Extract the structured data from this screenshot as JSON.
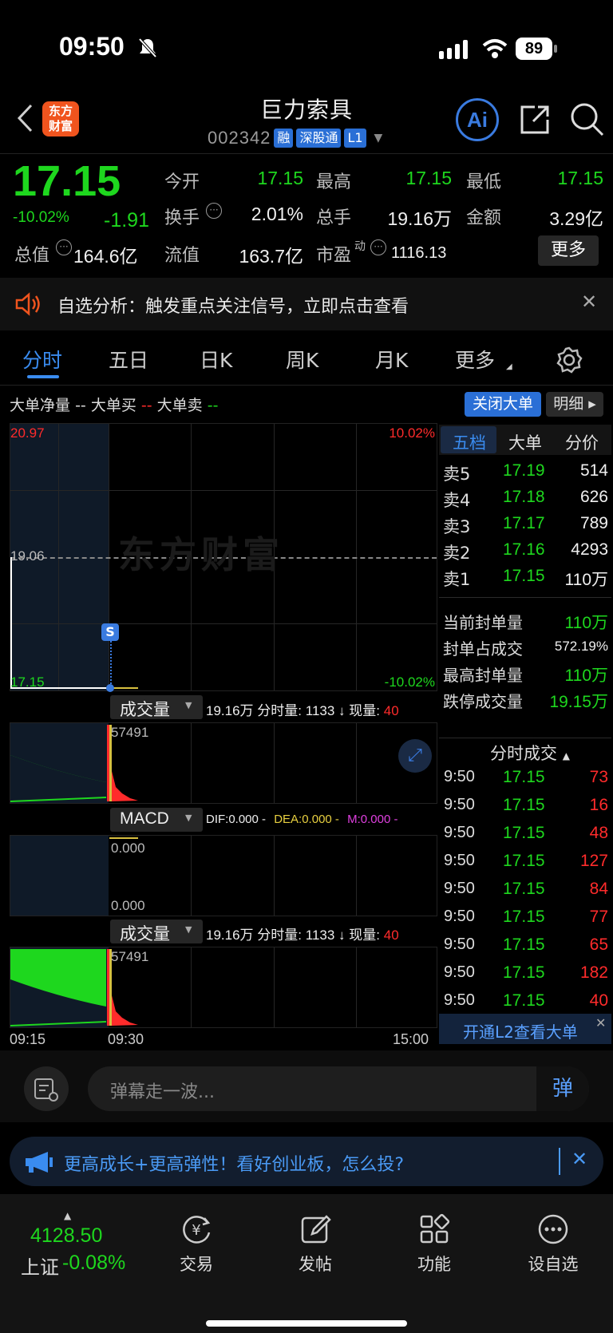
{
  "status": {
    "time": "09:50",
    "battery": "89"
  },
  "header": {
    "logo": "东方财富",
    "title": "巨力索具",
    "code": "002342",
    "tags": [
      "融",
      "深股通",
      "L1"
    ]
  },
  "quote": {
    "price": "17.15",
    "change_pct": "-10.02%",
    "change": "-1.91",
    "fields": [
      {
        "label": "今开",
        "value": "17.15",
        "color": "green"
      },
      {
        "label": "最高",
        "value": "17.15",
        "color": "green"
      },
      {
        "label": "最低",
        "value": "17.15",
        "color": "green"
      },
      {
        "label": "换手",
        "value": "2.01%",
        "color": "white"
      },
      {
        "label": "总手",
        "value": "19.16万",
        "color": "white"
      },
      {
        "label": "金额",
        "value": "3.29亿",
        "color": "white"
      },
      {
        "label": "总值",
        "value": "164.6亿",
        "color": "white"
      },
      {
        "label": "流值",
        "value": "163.7亿",
        "color": "white"
      },
      {
        "label": "市盈",
        "value": "1116.13",
        "color": "white"
      }
    ],
    "pe_sup": "动",
    "more": "更多"
  },
  "notice": {
    "text": "自选分析：触发重点关注信号，立即点击查看"
  },
  "tabs": [
    "分时",
    "五日",
    "日K",
    "周K",
    "月K",
    "更多"
  ],
  "bigorder": {
    "net": "大单净量",
    "net_val": "--",
    "buy": "大单买",
    "buy_val": "--",
    "sell": "大单卖",
    "sell_val": "--",
    "close_btn": "关闭大单",
    "detail_btn": "明细"
  },
  "chart": {
    "y_top": "20.97",
    "y_mid": "19.06",
    "y_bot": "17.15",
    "pct_top": "10.02%",
    "pct_bot": "-10.02%",
    "watermark": "东方财富",
    "marker": "S",
    "x_start": "09:15",
    "x_mid": "09:30",
    "x_end": "15:00"
  },
  "volume": {
    "label": "成交量",
    "summary": "19.16万",
    "fenshi_label": "分时量:",
    "fenshi_val": "1133",
    "arrow": "↓",
    "now_label": "现量:",
    "now_val": "40",
    "peak": "57491"
  },
  "macd": {
    "label": "MACD",
    "dif": "DIF:0.000 -",
    "dea": "DEA:0.000 -",
    "m": "M:0.000 -",
    "top": "0.000",
    "bot": "0.000"
  },
  "sidetabs": [
    "五档",
    "大单",
    "分价"
  ],
  "orderbook": [
    {
      "label": "卖5",
      "price": "17.19",
      "vol": "514"
    },
    {
      "label": "卖4",
      "price": "17.18",
      "vol": "626"
    },
    {
      "label": "卖3",
      "price": "17.17",
      "vol": "789"
    },
    {
      "label": "卖2",
      "price": "17.16",
      "vol": "4293"
    },
    {
      "label": "卖1",
      "price": "17.15",
      "vol": "110万"
    }
  ],
  "seal": [
    {
      "label": "当前封单量",
      "value": "110万",
      "color": "green"
    },
    {
      "label": "封单占成交",
      "value": "572.19%",
      "color": "white"
    },
    {
      "label": "最高封单量",
      "value": "110万",
      "color": "green"
    },
    {
      "label": "跌停成交量",
      "value": "19.15万",
      "color": "green"
    }
  ],
  "ticks_title": "分时成交",
  "ticks": [
    {
      "t": "9:50",
      "p": "17.15",
      "v": "73"
    },
    {
      "t": "9:50",
      "p": "17.15",
      "v": "16"
    },
    {
      "t": "9:50",
      "p": "17.15",
      "v": "48"
    },
    {
      "t": "9:50",
      "p": "17.15",
      "v": "127"
    },
    {
      "t": "9:50",
      "p": "17.15",
      "v": "84"
    },
    {
      "t": "9:50",
      "p": "17.15",
      "v": "77"
    },
    {
      "t": "9:50",
      "p": "17.15",
      "v": "65"
    },
    {
      "t": "9:50",
      "p": "17.15",
      "v": "182"
    },
    {
      "t": "9:50",
      "p": "17.15",
      "v": "40"
    }
  ],
  "l2_banner": "开通L2查看大单",
  "danmu": {
    "placeholder": "弹幕走一波...",
    "btn": "弹"
  },
  "promo": {
    "text": "更高成长+更高弹性！看好创业板，怎么投?"
  },
  "bottom": {
    "index_val": "4128.50",
    "index_name": "上证",
    "index_pct": "-0.08%",
    "nav": [
      "交易",
      "发帖",
      "功能",
      "设自选"
    ]
  },
  "colors": {
    "up": "#ff2b2b",
    "down": "#1ed71e",
    "accent": "#2a6fd6",
    "brand": "#f0541e"
  }
}
